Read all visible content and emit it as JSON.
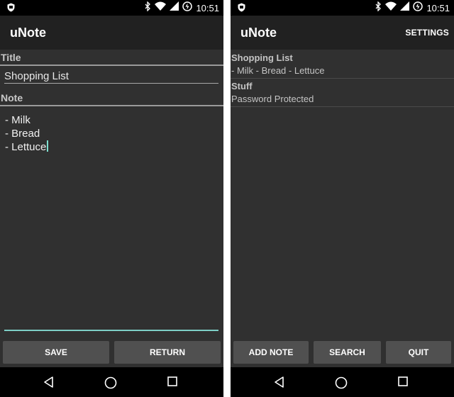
{
  "status_bar": {
    "time": "10:51"
  },
  "editor_screen": {
    "app_title": "uNote",
    "title_label": "Title",
    "title_value": "Shopping List",
    "note_label": "Note",
    "note_lines": [
      "- Milk",
      "- Bread",
      "- Lettuce"
    ],
    "save_label": "SAVE",
    "return_label": "RETURN"
  },
  "list_screen": {
    "app_title": "uNote",
    "settings_label": "SETTINGS",
    "notes": [
      {
        "title": "Shopping List",
        "subtitle": "- Milk - Bread - Lettuce"
      },
      {
        "title": "Stuff",
        "subtitle": "Password Protected"
      }
    ],
    "add_note_label": "ADD NOTE",
    "search_label": "SEARCH",
    "quit_label": "QUIT"
  },
  "colors": {
    "background": "#303030",
    "app_bar": "#212121",
    "button": "#505050",
    "accent_teal": "#7ecfc6"
  },
  "icons": [
    "shield-icon",
    "bluetooth-icon",
    "wifi-icon",
    "signal-icon",
    "battery-charging-icon",
    "back-icon",
    "home-icon",
    "recent-apps-icon"
  ]
}
